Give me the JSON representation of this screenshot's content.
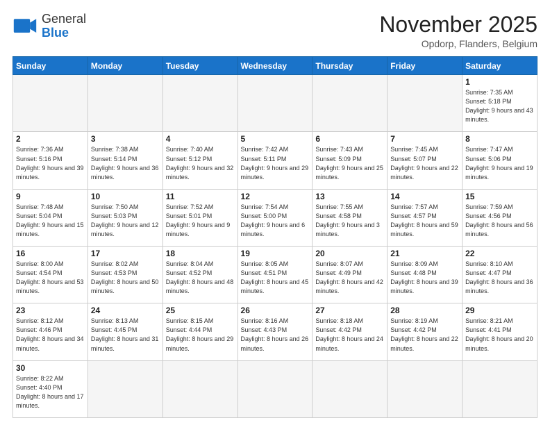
{
  "header": {
    "logo_general": "General",
    "logo_blue": "Blue",
    "month_title": "November 2025",
    "location": "Opdorp, Flanders, Belgium"
  },
  "weekdays": [
    "Sunday",
    "Monday",
    "Tuesday",
    "Wednesday",
    "Thursday",
    "Friday",
    "Saturday"
  ],
  "weeks": [
    [
      {
        "day": "",
        "info": "",
        "empty": true
      },
      {
        "day": "",
        "info": "",
        "empty": true
      },
      {
        "day": "",
        "info": "",
        "empty": true
      },
      {
        "day": "",
        "info": "",
        "empty": true
      },
      {
        "day": "",
        "info": "",
        "empty": true
      },
      {
        "day": "",
        "info": "",
        "empty": true
      },
      {
        "day": "1",
        "info": "Sunrise: 7:35 AM\nSunset: 5:18 PM\nDaylight: 9 hours\nand 43 minutes."
      }
    ],
    [
      {
        "day": "2",
        "info": "Sunrise: 7:36 AM\nSunset: 5:16 PM\nDaylight: 9 hours\nand 39 minutes."
      },
      {
        "day": "3",
        "info": "Sunrise: 7:38 AM\nSunset: 5:14 PM\nDaylight: 9 hours\nand 36 minutes."
      },
      {
        "day": "4",
        "info": "Sunrise: 7:40 AM\nSunset: 5:12 PM\nDaylight: 9 hours\nand 32 minutes."
      },
      {
        "day": "5",
        "info": "Sunrise: 7:42 AM\nSunset: 5:11 PM\nDaylight: 9 hours\nand 29 minutes."
      },
      {
        "day": "6",
        "info": "Sunrise: 7:43 AM\nSunset: 5:09 PM\nDaylight: 9 hours\nand 25 minutes."
      },
      {
        "day": "7",
        "info": "Sunrise: 7:45 AM\nSunset: 5:07 PM\nDaylight: 9 hours\nand 22 minutes."
      },
      {
        "day": "8",
        "info": "Sunrise: 7:47 AM\nSunset: 5:06 PM\nDaylight: 9 hours\nand 19 minutes."
      }
    ],
    [
      {
        "day": "9",
        "info": "Sunrise: 7:48 AM\nSunset: 5:04 PM\nDaylight: 9 hours\nand 15 minutes."
      },
      {
        "day": "10",
        "info": "Sunrise: 7:50 AM\nSunset: 5:03 PM\nDaylight: 9 hours\nand 12 minutes."
      },
      {
        "day": "11",
        "info": "Sunrise: 7:52 AM\nSunset: 5:01 PM\nDaylight: 9 hours\nand 9 minutes."
      },
      {
        "day": "12",
        "info": "Sunrise: 7:54 AM\nSunset: 5:00 PM\nDaylight: 9 hours\nand 6 minutes."
      },
      {
        "day": "13",
        "info": "Sunrise: 7:55 AM\nSunset: 4:58 PM\nDaylight: 9 hours\nand 3 minutes."
      },
      {
        "day": "14",
        "info": "Sunrise: 7:57 AM\nSunset: 4:57 PM\nDaylight: 8 hours\nand 59 minutes."
      },
      {
        "day": "15",
        "info": "Sunrise: 7:59 AM\nSunset: 4:56 PM\nDaylight: 8 hours\nand 56 minutes."
      }
    ],
    [
      {
        "day": "16",
        "info": "Sunrise: 8:00 AM\nSunset: 4:54 PM\nDaylight: 8 hours\nand 53 minutes."
      },
      {
        "day": "17",
        "info": "Sunrise: 8:02 AM\nSunset: 4:53 PM\nDaylight: 8 hours\nand 50 minutes."
      },
      {
        "day": "18",
        "info": "Sunrise: 8:04 AM\nSunset: 4:52 PM\nDaylight: 8 hours\nand 48 minutes."
      },
      {
        "day": "19",
        "info": "Sunrise: 8:05 AM\nSunset: 4:51 PM\nDaylight: 8 hours\nand 45 minutes."
      },
      {
        "day": "20",
        "info": "Sunrise: 8:07 AM\nSunset: 4:49 PM\nDaylight: 8 hours\nand 42 minutes."
      },
      {
        "day": "21",
        "info": "Sunrise: 8:09 AM\nSunset: 4:48 PM\nDaylight: 8 hours\nand 39 minutes."
      },
      {
        "day": "22",
        "info": "Sunrise: 8:10 AM\nSunset: 4:47 PM\nDaylight: 8 hours\nand 36 minutes."
      }
    ],
    [
      {
        "day": "23",
        "info": "Sunrise: 8:12 AM\nSunset: 4:46 PM\nDaylight: 8 hours\nand 34 minutes."
      },
      {
        "day": "24",
        "info": "Sunrise: 8:13 AM\nSunset: 4:45 PM\nDaylight: 8 hours\nand 31 minutes."
      },
      {
        "day": "25",
        "info": "Sunrise: 8:15 AM\nSunset: 4:44 PM\nDaylight: 8 hours\nand 29 minutes."
      },
      {
        "day": "26",
        "info": "Sunrise: 8:16 AM\nSunset: 4:43 PM\nDaylight: 8 hours\nand 26 minutes."
      },
      {
        "day": "27",
        "info": "Sunrise: 8:18 AM\nSunset: 4:42 PM\nDaylight: 8 hours\nand 24 minutes."
      },
      {
        "day": "28",
        "info": "Sunrise: 8:19 AM\nSunset: 4:42 PM\nDaylight: 8 hours\nand 22 minutes."
      },
      {
        "day": "29",
        "info": "Sunrise: 8:21 AM\nSunset: 4:41 PM\nDaylight: 8 hours\nand 20 minutes."
      }
    ],
    [
      {
        "day": "30",
        "info": "Sunrise: 8:22 AM\nSunset: 4:40 PM\nDaylight: 8 hours\nand 17 minutes.",
        "last": true
      },
      {
        "day": "",
        "info": "",
        "empty": true,
        "last": true
      },
      {
        "day": "",
        "info": "",
        "empty": true,
        "last": true
      },
      {
        "day": "",
        "info": "",
        "empty": true,
        "last": true
      },
      {
        "day": "",
        "info": "",
        "empty": true,
        "last": true
      },
      {
        "day": "",
        "info": "",
        "empty": true,
        "last": true
      },
      {
        "day": "",
        "info": "",
        "empty": true,
        "last": true
      }
    ]
  ]
}
